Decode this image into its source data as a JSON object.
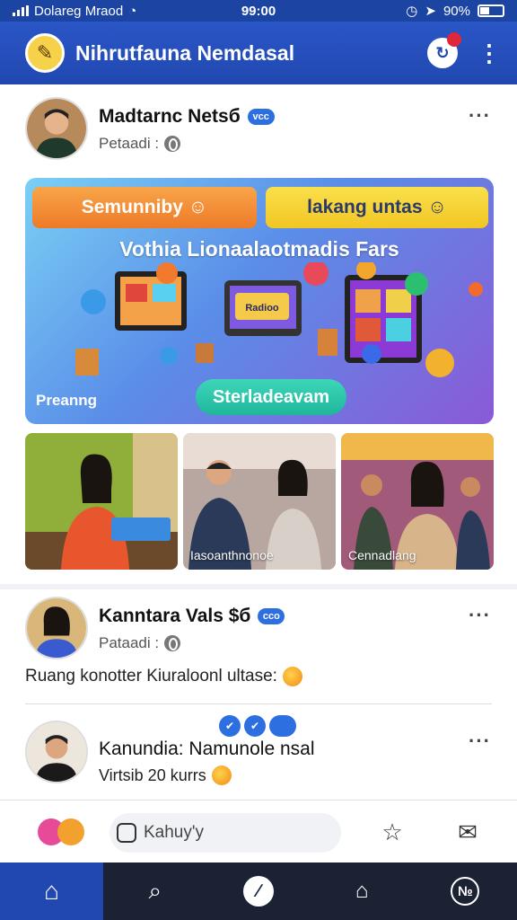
{
  "status_bar": {
    "carrier": "Dolareg Mraod",
    "time": "99:00",
    "battery": "90%"
  },
  "header": {
    "title": "Nihrutfauna Nemdasal",
    "logo_icon": "book-icon",
    "notification_icon": "notification-icon",
    "menu_icon": "kebab-menu-icon",
    "brand_color": "#2148b1"
  },
  "post1": {
    "author": "Madtarnc Netsб",
    "badge": "vcc",
    "meta": "Petaadi :",
    "banner": {
      "pill_left": "Semunniby",
      "pill_right": "lakang untas",
      "headline": "Vothia Lionaalaotmadis Fars",
      "screen_label": "Radioo",
      "left_label": "Preanng",
      "cta": "Sterladeavam"
    },
    "photos": [
      {
        "caption": ""
      },
      {
        "caption": "Iasoanthnonoe"
      },
      {
        "caption": "Cennadlang"
      }
    ]
  },
  "post2": {
    "author": "Kanntara Vals $б",
    "badge": "cco",
    "meta": "Pataadi :",
    "body": "Ruang konotter Kiuraloonl ultasе:",
    "reply": {
      "author": "Kanundia: Namunolе nsal",
      "text": "Virtsib 20 kurrs"
    }
  },
  "composer": {
    "placeholder": "Kahuy'y"
  },
  "bottom_nav": [
    {
      "icon": "home-icon",
      "active": true
    },
    {
      "icon": "search-icon",
      "active": false
    },
    {
      "icon": "compose-icon",
      "active": false
    },
    {
      "icon": "notifications-icon",
      "active": false
    },
    {
      "icon": "profile-icon",
      "active": false
    }
  ]
}
